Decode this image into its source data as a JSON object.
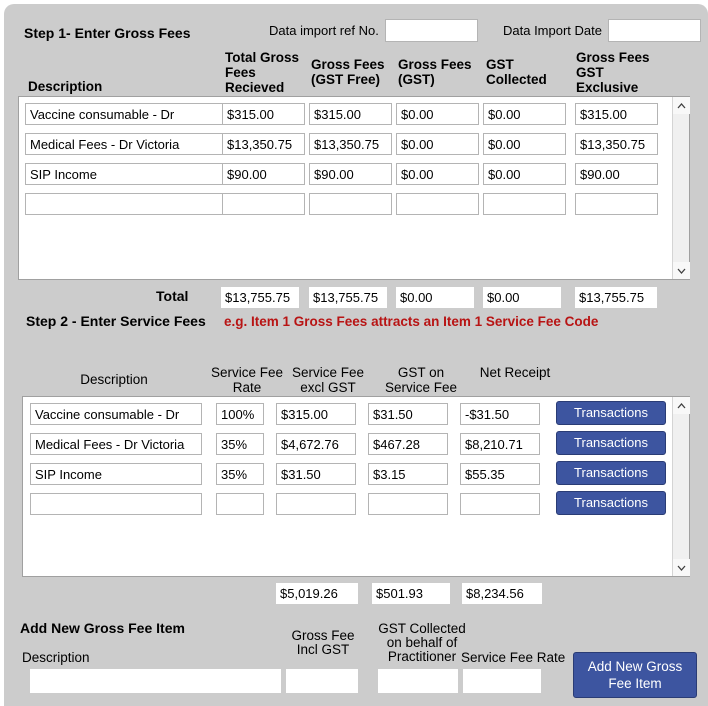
{
  "step1": {
    "title": "Step 1- Enter Gross Fees",
    "import_ref_label": "Data import ref No.",
    "import_ref_value": "",
    "import_date_label": "Data Import Date",
    "import_date_value": "",
    "columns": [
      "Description",
      "Total Gross\nFees\nRecieved",
      "Gross Fees\n(GST Free)",
      "Gross Fees\n(GST)",
      "GST\nCollected",
      "Gross Fees\nGST\nExclusive"
    ],
    "rows": [
      {
        "description": "Vaccine consumable - Dr",
        "total_gross_fees_received": "$315.00",
        "gross_fees_gst_free": "$315.00",
        "gross_fees_gst": "$0.00",
        "gst_collected": "$0.00",
        "gross_fees_gst_exclusive": "$315.00"
      },
      {
        "description": "Medical Fees - Dr Victoria",
        "total_gross_fees_received": "$13,350.75",
        "gross_fees_gst_free": "$13,350.75",
        "gross_fees_gst": "$0.00",
        "gst_collected": "$0.00",
        "gross_fees_gst_exclusive": "$13,350.75"
      },
      {
        "description": "SIP Income",
        "total_gross_fees_received": "$90.00",
        "gross_fees_gst_free": "$90.00",
        "gross_fees_gst": "$0.00",
        "gst_collected": "$0.00",
        "gross_fees_gst_exclusive": "$90.00"
      },
      {
        "description": "",
        "total_gross_fees_received": "",
        "gross_fees_gst_free": "",
        "gross_fees_gst": "",
        "gst_collected": "",
        "gross_fees_gst_exclusive": ""
      }
    ],
    "total_label": "Total",
    "totals": {
      "total_gross_fees_received": "$13,755.75",
      "gross_fees_gst_free": "$13,755.75",
      "gross_fees_gst": "$0.00",
      "gst_collected": "$0.00",
      "gross_fees_gst_exclusive": "$13,755.75"
    }
  },
  "step2": {
    "title": "Step 2 - Enter Service Fees",
    "hint": "e.g. Item 1  Gross Fees attracts  an Item 1 Service Fee Code",
    "hint_color": "#b81414",
    "columns": [
      "Description",
      "Service Fee\nRate",
      "Service Fee\nexcl GST",
      "GST on\nService Fee",
      "Net Receipt"
    ],
    "rows": [
      {
        "description": "Vaccine consumable - Dr",
        "service_fee_rate": "100%",
        "service_fee_excl_gst": "$315.00",
        "gst_on_service_fee": "$31.50",
        "net_receipt": "-$31.50",
        "action": "Transactions"
      },
      {
        "description": "Medical Fees - Dr Victoria",
        "service_fee_rate": "35%",
        "service_fee_excl_gst": "$4,672.76",
        "gst_on_service_fee": "$467.28",
        "net_receipt": "$8,210.71",
        "action": "Transactions"
      },
      {
        "description": "SIP Income",
        "service_fee_rate": "35%",
        "service_fee_excl_gst": "$31.50",
        "gst_on_service_fee": "$3.15",
        "net_receipt": "$55.35",
        "action": "Transactions"
      },
      {
        "description": "",
        "service_fee_rate": "",
        "service_fee_excl_gst": "",
        "gst_on_service_fee": "",
        "net_receipt": "",
        "action": "Transactions"
      }
    ],
    "totals": {
      "service_fee_excl_gst": "$5,019.26",
      "gst_on_service_fee": "$501.93",
      "net_receipt": "$8,234.56"
    }
  },
  "add_new": {
    "title": "Add New Gross Fee Item",
    "description_label": "Description",
    "gross_fee_incl_gst_label": "Gross Fee\nIncl GST",
    "gst_collected_label": "GST Collected\non behalf of\nPractitioner",
    "service_fee_rate_label": "Service Fee Rate",
    "description_value": "",
    "gross_fee_incl_gst_value": "",
    "gst_collected_value": "",
    "service_fee_rate_value": "",
    "button_label": "Add New Gross\nFee Item"
  },
  "colors": {
    "panel_background": "#cccccc",
    "accent_blue": "#3d55a0",
    "hint_red": "#b81414",
    "field_background": "#ffffff"
  },
  "icons": {
    "scroll_up": "chevron-up-icon",
    "scroll_down": "chevron-down-icon"
  }
}
